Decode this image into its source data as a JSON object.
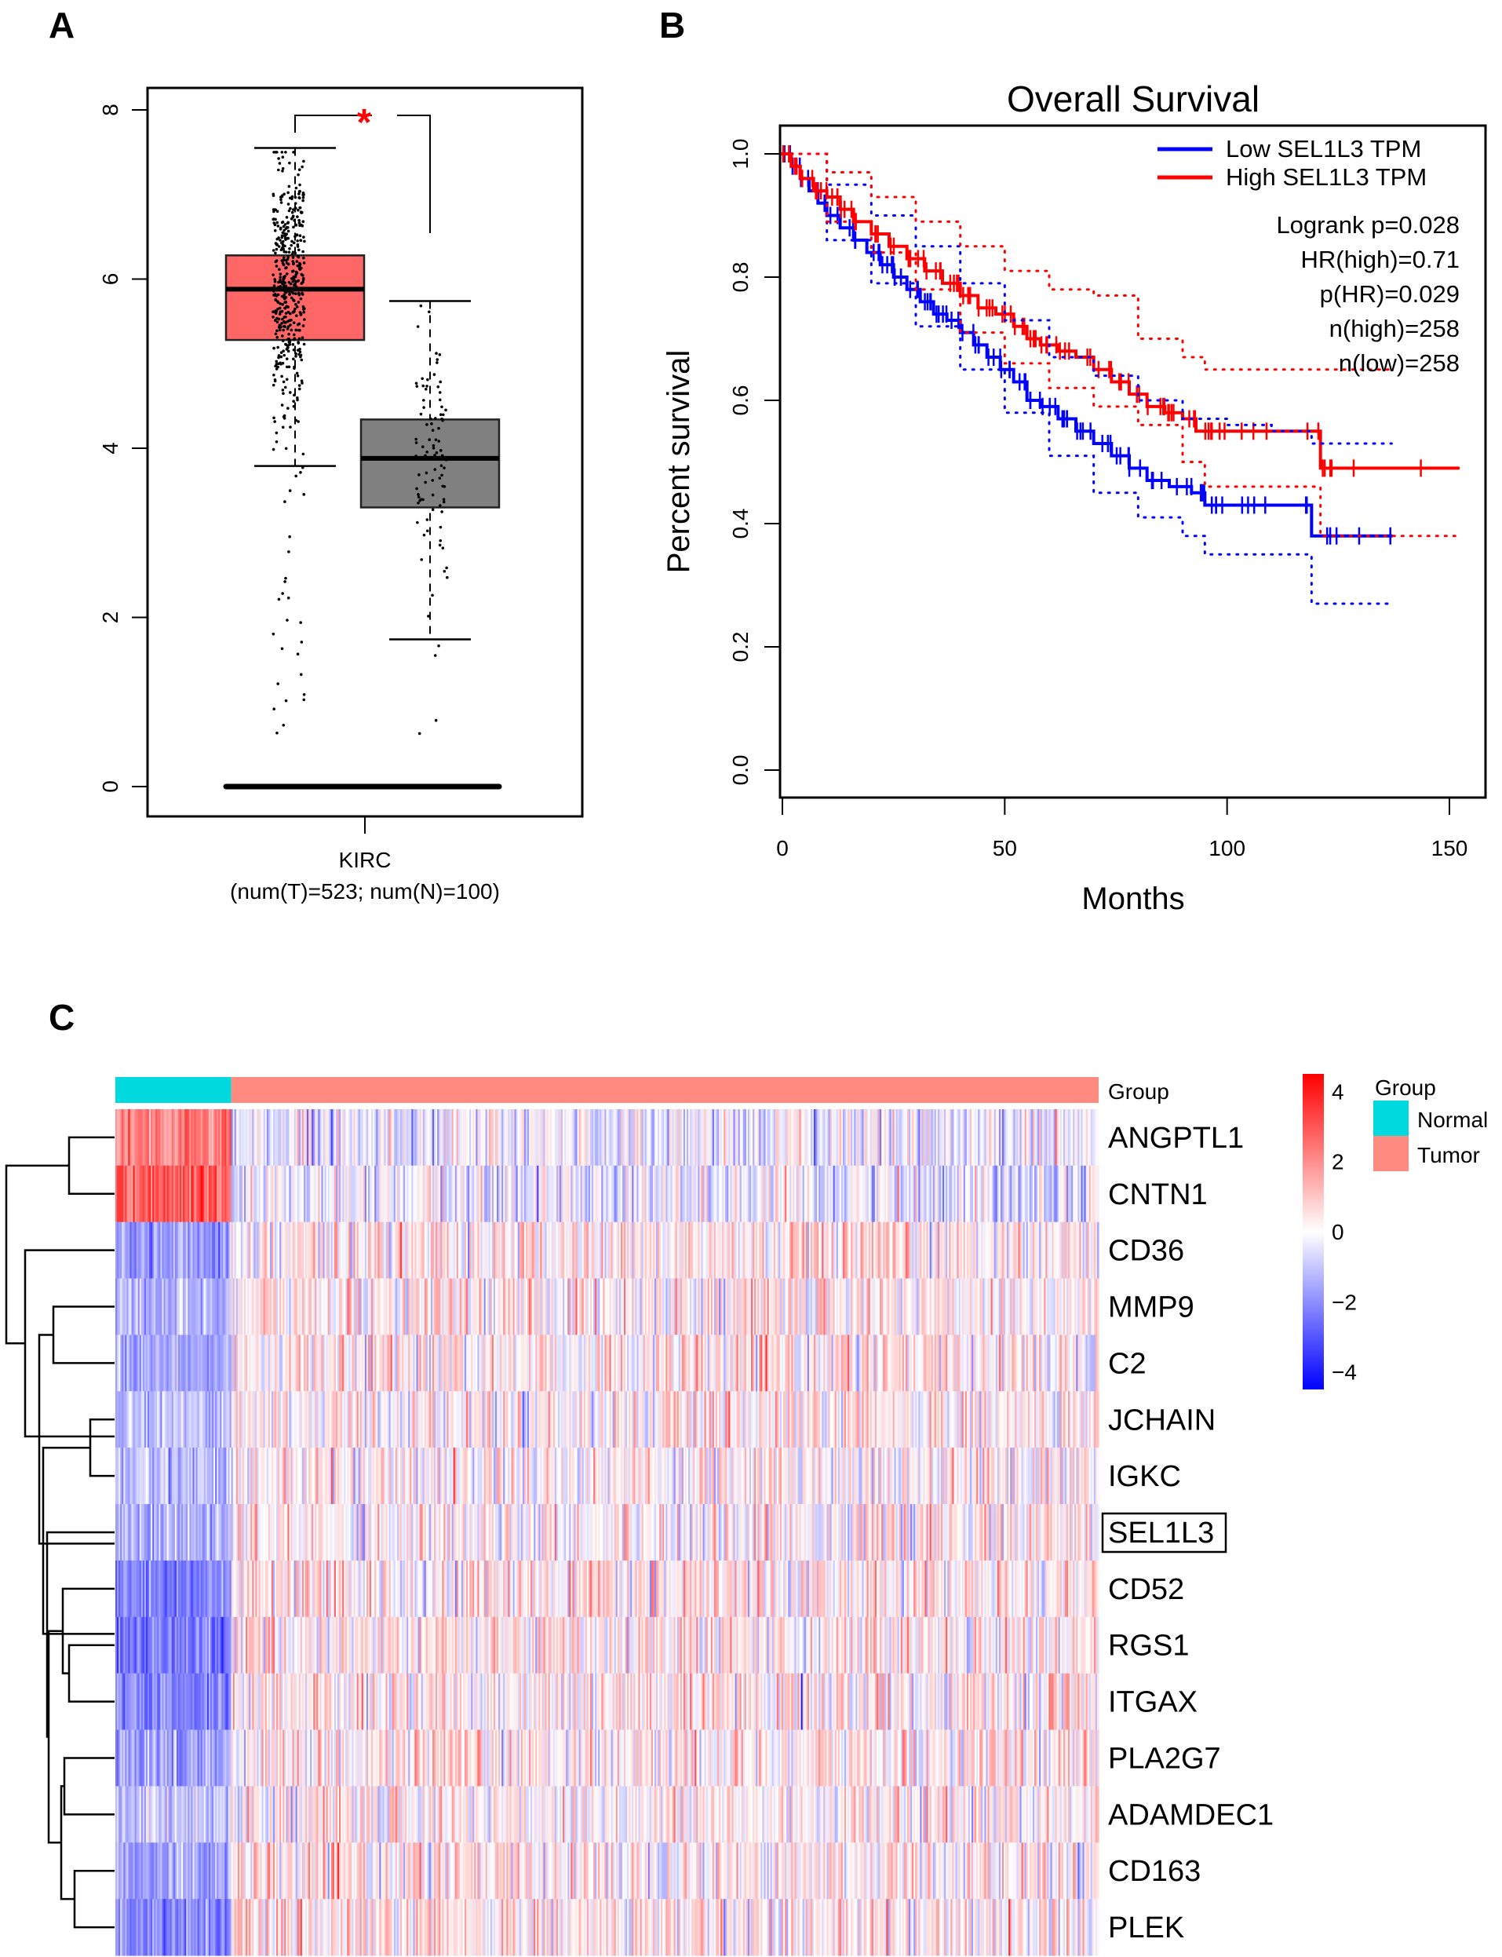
{
  "chart_data": [
    {
      "panel": "A",
      "type": "box",
      "title": "",
      "xlabel": "KIRC",
      "xlabel_sub": "(num(T)=523; num(N)=100)",
      "ylabel": "",
      "ylim": [
        0,
        8
      ],
      "yticks": [
        "0",
        "2",
        "4",
        "6",
        "8"
      ],
      "significance_marker": "*",
      "groups": [
        {
          "name": "Tumor",
          "n": 523,
          "color": "#ff6666",
          "q1": 5.28,
          "median": 5.88,
          "q3": 6.28,
          "whisker_low": 3.79,
          "whisker_high": 7.55,
          "zero_line": true
        },
        {
          "name": "Normal",
          "n": 100,
          "color": "#808080",
          "q1": 3.3,
          "median": 3.88,
          "q3": 4.34,
          "whisker_low": 1.74,
          "whisker_high": 5.74,
          "zero_line": true
        }
      ]
    },
    {
      "panel": "B",
      "type": "line",
      "title": "Overall Survival",
      "xlabel": "Months",
      "ylabel": "Percent survival",
      "xlim": [
        0,
        155
      ],
      "ylim": [
        0,
        1.0
      ],
      "xticks": [
        "0",
        "50",
        "100",
        "150"
      ],
      "yticks": [
        "0.0",
        "0.2",
        "0.4",
        "0.6",
        "0.8",
        "1.0"
      ],
      "legend_position": "top-right",
      "legend": [
        {
          "label": "Low SEL1L3 TPM",
          "color": "#0000ff"
        },
        {
          "label": "High SEL1L3 TPM",
          "color": "#ff0000"
        }
      ],
      "stats": [
        "Logrank p=0.028",
        "HR(high)=0.71",
        "p(HR)=0.029",
        "n(high)=258",
        "n(low)=258"
      ],
      "series": [
        {
          "name": "Low SEL1L3 TPM",
          "color": "#0000ff",
          "x": [
            0,
            2,
            4,
            6,
            8,
            10,
            13,
            16,
            19,
            22,
            25,
            28,
            31,
            34,
            37,
            40,
            43,
            46,
            49,
            52,
            55,
            58,
            62,
            66,
            70,
            74,
            78,
            82,
            87,
            92,
            95,
            100,
            110,
            119,
            125,
            137
          ],
          "y": [
            1.0,
            0.98,
            0.96,
            0.94,
            0.92,
            0.9,
            0.88,
            0.86,
            0.84,
            0.82,
            0.8,
            0.78,
            0.76,
            0.74,
            0.73,
            0.71,
            0.69,
            0.67,
            0.65,
            0.63,
            0.6,
            0.59,
            0.57,
            0.55,
            0.53,
            0.51,
            0.49,
            0.47,
            0.46,
            0.45,
            0.43,
            0.43,
            0.43,
            0.38,
            0.38,
            0.38
          ]
        },
        {
          "name": "High SEL1L3 TPM",
          "color": "#ff0000",
          "x": [
            0,
            2,
            4,
            7,
            10,
            13,
            16,
            20,
            24,
            28,
            32,
            36,
            40,
            44,
            48,
            52,
            55,
            58,
            62,
            66,
            70,
            74,
            78,
            82,
            86,
            90,
            93,
            96,
            100,
            110,
            121,
            125,
            152
          ],
          "y": [
            1.0,
            0.98,
            0.96,
            0.94,
            0.93,
            0.91,
            0.89,
            0.87,
            0.85,
            0.83,
            0.81,
            0.79,
            0.77,
            0.75,
            0.74,
            0.72,
            0.7,
            0.69,
            0.68,
            0.67,
            0.65,
            0.63,
            0.61,
            0.59,
            0.58,
            0.57,
            0.55,
            0.55,
            0.55,
            0.55,
            0.49,
            0.49,
            0.49
          ]
        },
        {
          "name": "Low SEL1L3 TPM upper CI",
          "color": "#0000ff",
          "style": "dotted",
          "x": [
            0,
            10,
            20,
            30,
            40,
            50,
            60,
            70,
            80,
            90,
            100,
            110,
            119,
            137
          ],
          "y": [
            1.0,
            0.95,
            0.9,
            0.85,
            0.79,
            0.73,
            0.67,
            0.64,
            0.6,
            0.57,
            0.56,
            0.55,
            0.53,
            0.53
          ]
        },
        {
          "name": "Low SEL1L3 TPM lower CI",
          "color": "#0000ff",
          "style": "dotted",
          "x": [
            0,
            10,
            20,
            30,
            40,
            50,
            60,
            70,
            80,
            90,
            95,
            100,
            119,
            137
          ],
          "y": [
            1.0,
            0.86,
            0.79,
            0.72,
            0.65,
            0.58,
            0.51,
            0.45,
            0.41,
            0.38,
            0.35,
            0.35,
            0.27,
            0.27
          ]
        },
        {
          "name": "High SEL1L3 TPM upper CI",
          "color": "#ff0000",
          "style": "dotted",
          "x": [
            0,
            10,
            20,
            30,
            40,
            50,
            60,
            70,
            80,
            90,
            95,
            100,
            120,
            137
          ],
          "y": [
            1.0,
            0.97,
            0.93,
            0.89,
            0.85,
            0.81,
            0.78,
            0.77,
            0.7,
            0.67,
            0.65,
            0.65,
            0.65,
            0.65
          ]
        },
        {
          "name": "High SEL1L3 TPM lower CI",
          "color": "#ff0000",
          "style": "dotted",
          "x": [
            0,
            10,
            20,
            30,
            40,
            50,
            60,
            70,
            80,
            90,
            95,
            100,
            119,
            121,
            152
          ],
          "y": [
            1.0,
            0.89,
            0.84,
            0.78,
            0.71,
            0.66,
            0.62,
            0.59,
            0.56,
            0.5,
            0.46,
            0.46,
            0.46,
            0.38,
            0.38
          ]
        }
      ]
    },
    {
      "panel": "C",
      "type": "heatmap",
      "title": "",
      "annotation_track_label": "Group",
      "groups": [
        {
          "name": "Normal",
          "color": "#00d9dd",
          "columns": 72
        },
        {
          "name": "Tumor",
          "color": "#ff8a80",
          "columns": 539
        }
      ],
      "rows": [
        "ANGPTL1",
        "CNTN1",
        "CD36",
        "MMP9",
        "C2",
        "JCHAIN",
        "IGKC",
        "SEL1L3",
        "CD52",
        "RGS1",
        "ITGAX",
        "PLA2G7",
        "ADAMDEC1",
        "CD163",
        "PLEK"
      ],
      "highlighted_row": "SEL1L3",
      "row_means": {
        "Normal": [
          2.2,
          2.8,
          -1.8,
          -1.3,
          -1.6,
          -1.0,
          -1.1,
          -1.4,
          -2.2,
          -2.4,
          -2.2,
          -1.6,
          -0.9,
          -1.5,
          -2.0
        ],
        "Tumor": [
          -0.3,
          -0.4,
          0.3,
          0.3,
          0.3,
          0.2,
          0.2,
          0.2,
          0.3,
          0.35,
          0.3,
          0.3,
          0.2,
          0.3,
          0.3
        ]
      },
      "colorbar": {
        "range": [
          -4.5,
          4.5
        ],
        "ticks": [
          "4",
          "2",
          "0",
          "−2",
          "−4"
        ],
        "tick_values": [
          4,
          2,
          0,
          -2,
          -4
        ],
        "low_color": "#0000ff",
        "mid_color": "#ffffff",
        "high_color": "#ff0000"
      },
      "legend_title": "Group",
      "legend_items": [
        {
          "label": "Normal",
          "color": "#00d9dd"
        },
        {
          "label": "Tumor",
          "color": "#ff8a80"
        }
      ]
    }
  ],
  "panel_labels": [
    "A",
    "B",
    "C"
  ]
}
